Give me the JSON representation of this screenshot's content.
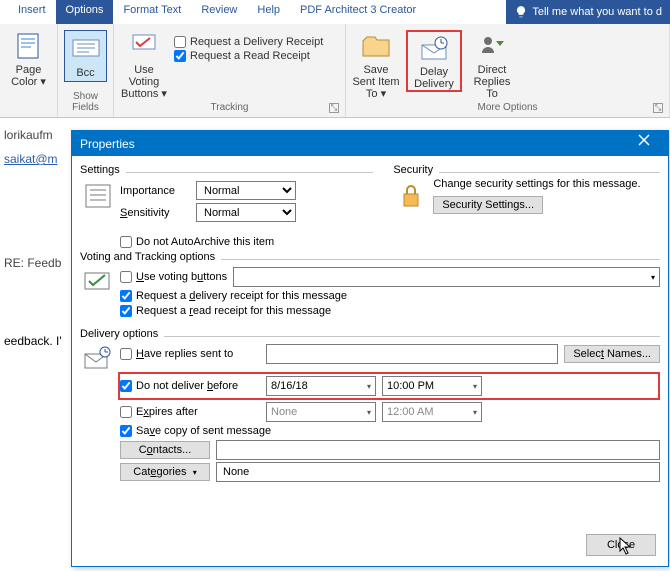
{
  "ribbon": {
    "tabs": [
      "Insert",
      "Options",
      "Format Text",
      "Review",
      "Help",
      "PDF Architect 3 Creator"
    ],
    "active_tab": "Options",
    "tellme": "Tell me what you want to d",
    "groups": {
      "page_color": "Page Color",
      "bcc": "Bcc",
      "show_fields": "Show Fields",
      "use_voting": "Use Voting Buttons",
      "req_delivery": "Request a Delivery Receipt",
      "req_read": "Request a Read Receipt",
      "tracking": "Tracking",
      "save_sent": "Save Sent Item To",
      "delay": "Delay Delivery",
      "direct": "Direct Replies To",
      "more_options": "More Options"
    }
  },
  "compose": {
    "from": "lorikaufm",
    "to": "saikat@m",
    "subject": "RE: Feedb",
    "body": "eedback. I'"
  },
  "dialog": {
    "title": "Properties",
    "settings": {
      "label": "Settings",
      "importance": "Importance",
      "importance_val": "Normal",
      "sensitivity": "Sensitivity",
      "sensitivity_val": "Normal",
      "autoarchive": "Do not AutoArchive this item"
    },
    "security": {
      "label": "Security",
      "text": "Change security settings for this message.",
      "btn": "Security Settings..."
    },
    "voting": {
      "label": "Voting and Tracking options",
      "use_voting": "Use voting buttons",
      "req_delivery": "Request a delivery receipt for this message",
      "req_read": "Request a read receipt for this message"
    },
    "delivery": {
      "label": "Delivery options",
      "have_replies": "Have replies sent to",
      "select_names": "Select Names...",
      "do_not_before": "Do not deliver before",
      "do_not_before_date": "8/16/18",
      "do_not_before_time": "10:00 PM",
      "expires": "Expires after",
      "expires_date": "None",
      "expires_time": "12:00 AM",
      "save_copy": "Save copy of sent message",
      "contacts": "Contacts...",
      "categories": "Categories",
      "categories_val": "None"
    },
    "close": "Close"
  }
}
